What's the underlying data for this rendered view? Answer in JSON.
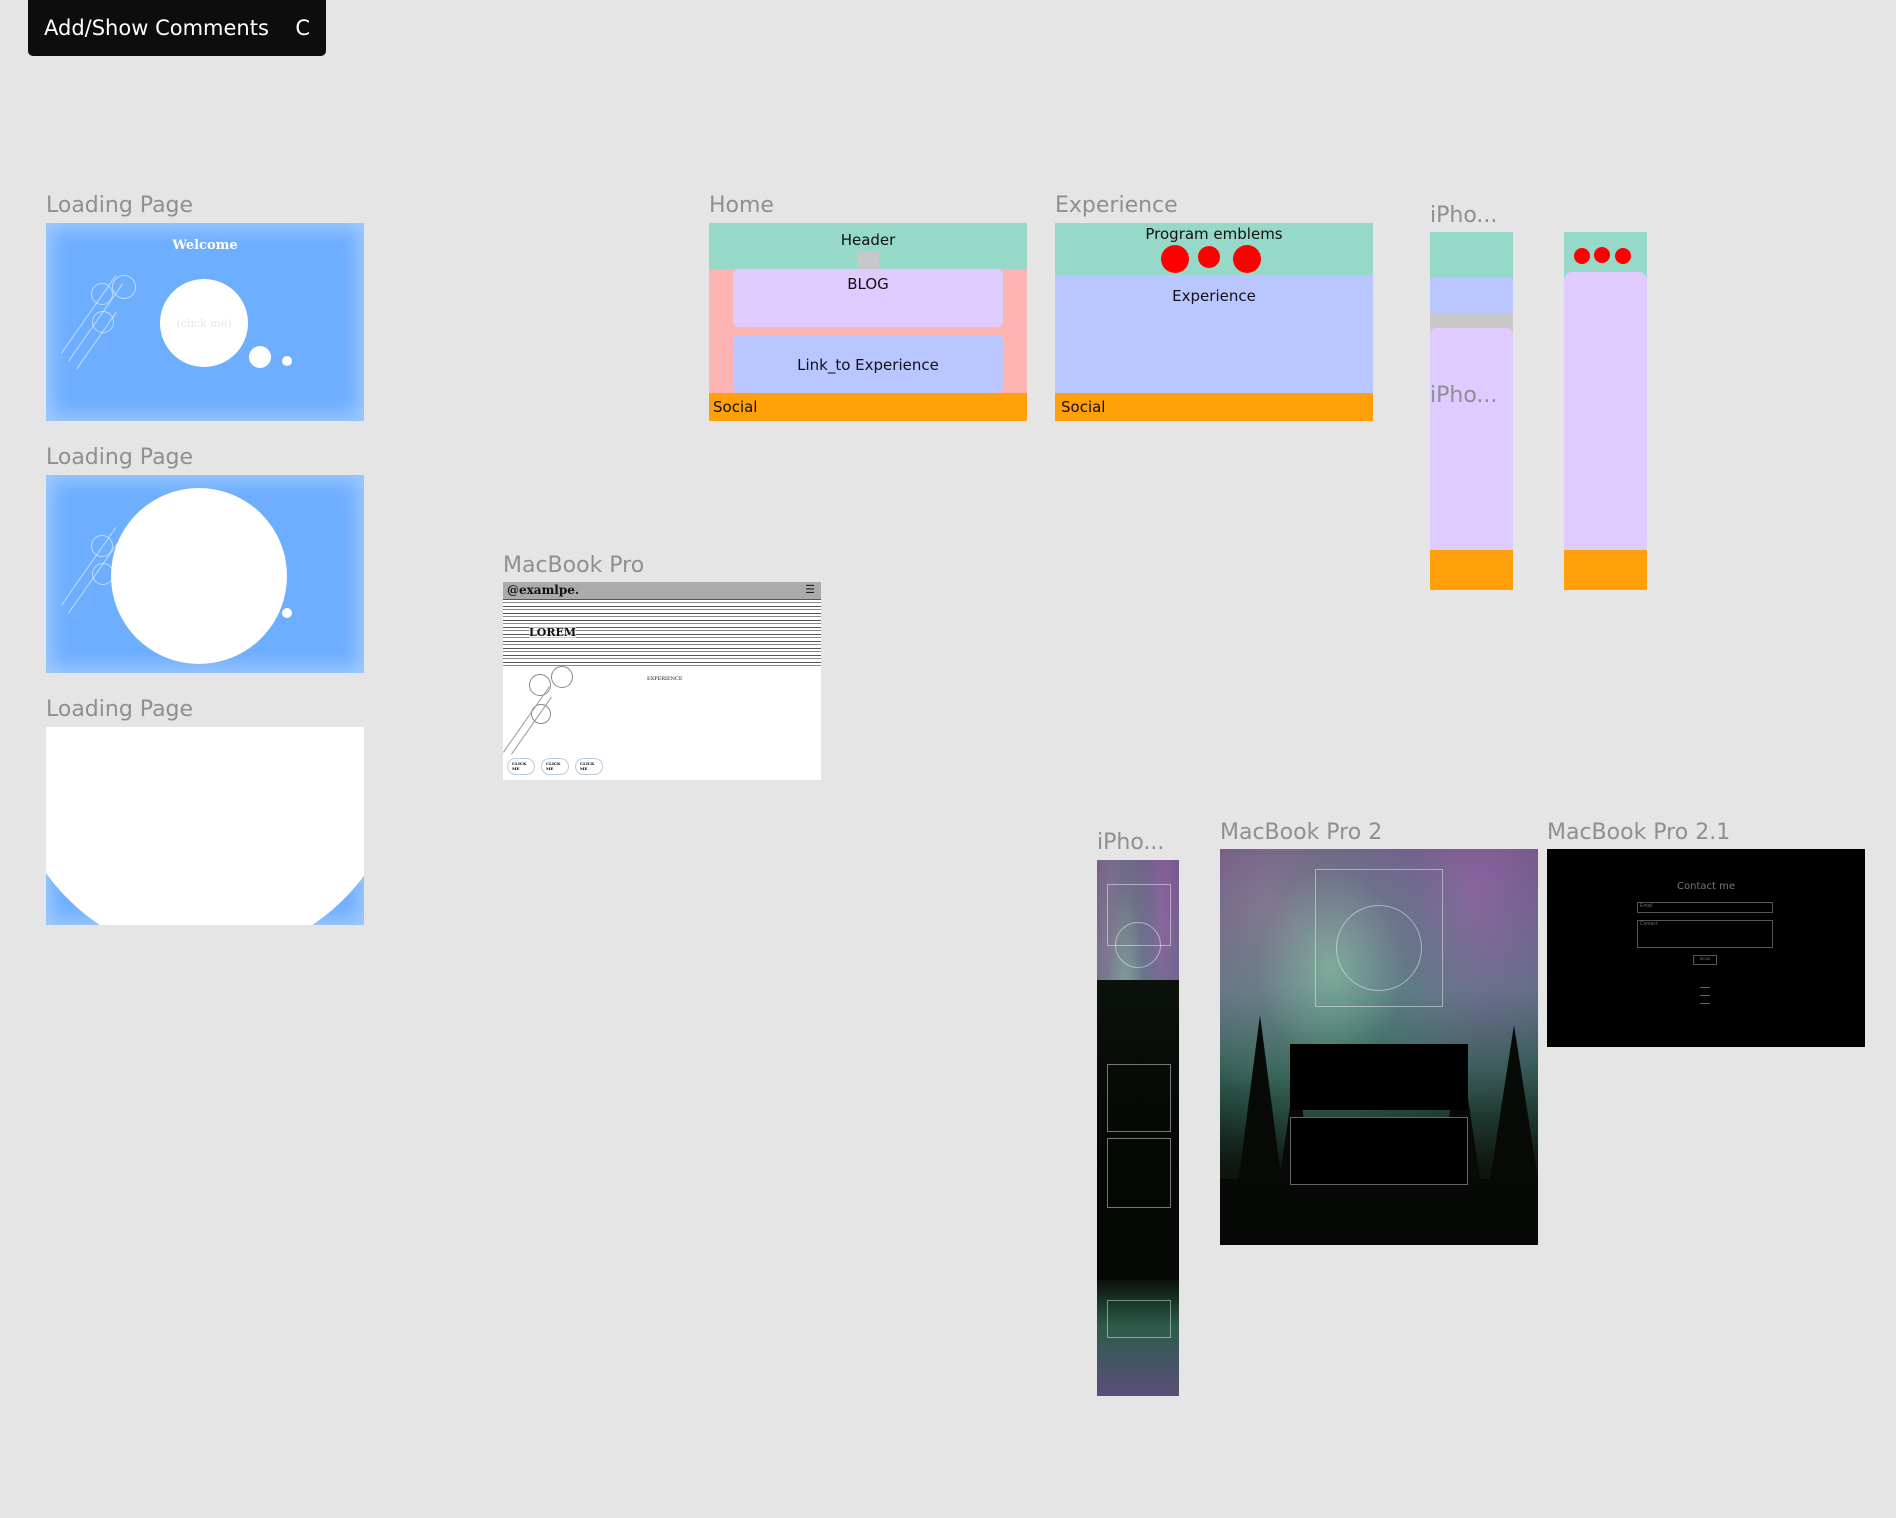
{
  "toolbar": {
    "comments_label": "Add/Show Comments",
    "comments_shortcut": "C"
  },
  "frames": {
    "loading1": {
      "label": "Loading Page",
      "welcome": "Welcome",
      "click": "(click me)"
    },
    "loading2": {
      "label": "Loading Page"
    },
    "loading3": {
      "label": "Loading Page"
    },
    "macbook": {
      "label": "MacBook Pro",
      "brand": "@examlpe.",
      "menu_icon": "☰",
      "hero": "LOREM",
      "section": "EXPERIENCE",
      "click_buttons": [
        "CLICK ME",
        "CLICK ME",
        "CLICK ME"
      ]
    },
    "home": {
      "label": "Home",
      "header": "Header",
      "blog": "BLOG",
      "link": "Link_to Experience",
      "social": "Social"
    },
    "experience": {
      "label": "Experience",
      "emblems": "Program emblems",
      "main": "Experience",
      "social": "Social"
    },
    "iphone1": {
      "label": "iPho...",
      "inner_label": "iPho..."
    },
    "iphone2": {
      "label": "iPho..."
    },
    "macbook2": {
      "label": "MacBook Pro 2"
    },
    "macbook21": {
      "label": "MacBook Pro 2.1",
      "contact": "Contact me",
      "email_ph": "Email",
      "contact_ph": "Contact",
      "send": "SEND"
    }
  },
  "colors": {
    "canvas": "#e5e5e5",
    "blue": "#6eaeff",
    "teal": "#96d9c8",
    "pink": "#ffb4b4",
    "lavender": "#dfcbff",
    "periwinkle": "#b9c6ff",
    "orange": "#ff9f0a",
    "red": "#ff0000"
  }
}
